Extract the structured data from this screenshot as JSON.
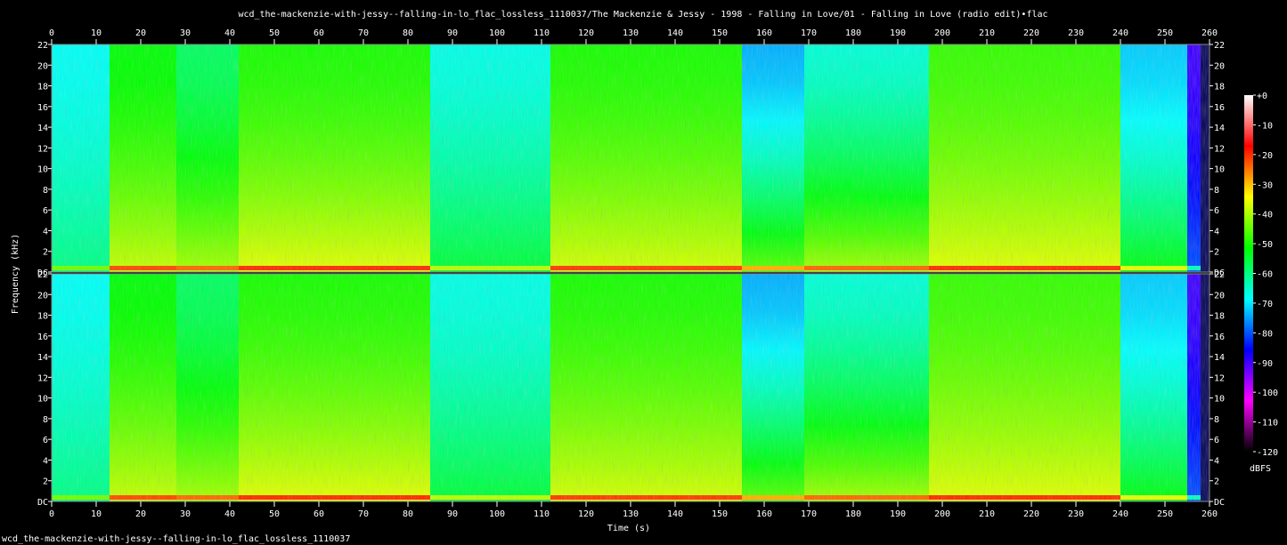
{
  "title": "wcd_the-mackenzie-with-jessy--falling-in-lo_flac_lossless_1110037/The Mackenzie & Jessy - 1998 - Falling in Love/01 - Falling in Love (radio edit)•flac",
  "footer": "wcd_the-mackenzie-with-jessy--falling-in-lo_flac_lossless_1110037",
  "chart_data": {
    "type": "heatmap",
    "title": "wcd_the-mackenzie-with-jessy--falling-in-lo_flac_lossless_1110037/The Mackenzie & Jessy - 1998 - Falling in Love/01 - Falling in Love (radio edit)•flac",
    "xlabel": "Time (s)",
    "ylabel": "Frequency (kHz)",
    "xlim": [
      0,
      260
    ],
    "ylim": [
      0,
      22
    ],
    "x_ticks": [
      "0",
      "10",
      "20",
      "30",
      "40",
      "50",
      "60",
      "70",
      "80",
      "90",
      "100",
      "110",
      "120",
      "130",
      "140",
      "150",
      "160",
      "170",
      "180",
      "190",
      "200",
      "210",
      "220",
      "230",
      "240",
      "250",
      "260"
    ],
    "y_ticks": [
      "DC",
      "2",
      "4",
      "6",
      "8",
      "10",
      "12",
      "14",
      "16",
      "18",
      "20",
      "22"
    ],
    "channels": 2,
    "colorbar": {
      "label": "dBFS",
      "range": [
        -120,
        0
      ],
      "ticks": [
        "+0",
        "-10",
        "-20",
        "-30",
        "-40",
        "-50",
        "-60",
        "-70",
        "-80",
        "-90",
        "-100",
        "-110",
        "-120"
      ],
      "colors": [
        "#ffffff",
        "#ff0000",
        "#ffff00",
        "#00ff00",
        "#00ffff",
        "#0000ff",
        "#ff00ff",
        "#000000"
      ]
    },
    "segments": [
      {
        "t": [
          0,
          13
        ],
        "cutoff_khz": 22,
        "hi_db": -68,
        "lo_db": -60
      },
      {
        "t": [
          13,
          28
        ],
        "cutoff_khz": 22,
        "hi_db": -52,
        "lo_db": -38
      },
      {
        "t": [
          28,
          42
        ],
        "cutoff_khz": 22,
        "hi_db": -58,
        "lo_db": -40
      },
      {
        "t": [
          42,
          85
        ],
        "cutoff_khz": 22,
        "hi_db": -50,
        "lo_db": -36
      },
      {
        "t": [
          85,
          112
        ],
        "cutoff_khz": 22,
        "hi_db": -67,
        "lo_db": -55
      },
      {
        "t": [
          112,
          155
        ],
        "cutoff_khz": 22,
        "hi_db": -50,
        "lo_db": -37
      },
      {
        "t": [
          155,
          169
        ],
        "cutoff_khz": 22,
        "hi_db": -74,
        "lo_db": -45
      },
      {
        "t": [
          169,
          197
        ],
        "cutoff_khz": 22,
        "hi_db": -66,
        "lo_db": -40
      },
      {
        "t": [
          197,
          240
        ],
        "cutoff_khz": 22,
        "hi_db": -48,
        "lo_db": -36
      },
      {
        "t": [
          240,
          255
        ],
        "cutoff_khz": 22,
        "hi_db": -72,
        "lo_db": -52
      },
      {
        "t": [
          255,
          258
        ],
        "cutoff_khz": 22,
        "hi_db": -90,
        "lo_db": -80
      }
    ]
  }
}
